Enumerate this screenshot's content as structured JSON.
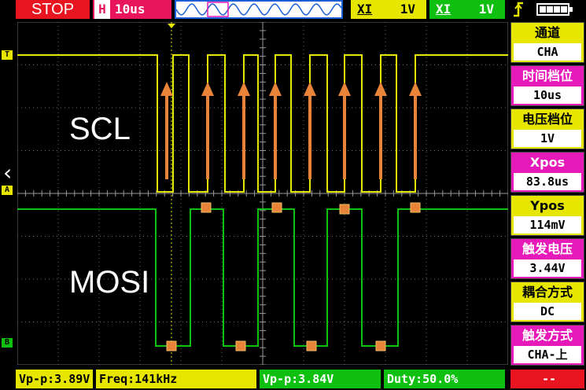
{
  "top": {
    "status": "STOP",
    "timebase_prefix": "H",
    "timebase": "10us",
    "ch1": {
      "coupling": "XI",
      "scale": "1V"
    },
    "ch2": {
      "coupling": "XI",
      "scale": "1V"
    }
  },
  "screen": {
    "label_scl": "SCL",
    "label_mosi": "MOSI",
    "marker_t": "T",
    "marker_a": "A",
    "marker_b": "B"
  },
  "menu": [
    {
      "title": "通道",
      "value": "CHA",
      "style": "yellow"
    },
    {
      "title": "时间档位",
      "value": "10us",
      "style": "magenta"
    },
    {
      "title": "电压档位",
      "value": "1V",
      "style": "yellow"
    },
    {
      "title": "Xpos",
      "value": "83.8us",
      "style": "magenta"
    },
    {
      "title": "Ypos",
      "value": "114mV",
      "style": "yellow"
    },
    {
      "title": "触发电压",
      "value": "3.44V",
      "style": "magenta"
    },
    {
      "title": "耦合方式",
      "value": "DC",
      "style": "yellow"
    },
    {
      "title": "触发方式",
      "value": "CHA-上",
      "style": "magenta"
    }
  ],
  "bottom": {
    "ch1_vpp": "Vp-p:3.89V",
    "ch1_freq": "Freq:141kHz",
    "ch2_vpp": "Vp-p:3.84V",
    "ch2_duty": "Duty:50.0%",
    "extra": "--"
  },
  "colors": {
    "ch1": "#e6e600",
    "ch2": "#10c010",
    "arrow": "#e8843a",
    "grid": "#6a6a6a"
  }
}
